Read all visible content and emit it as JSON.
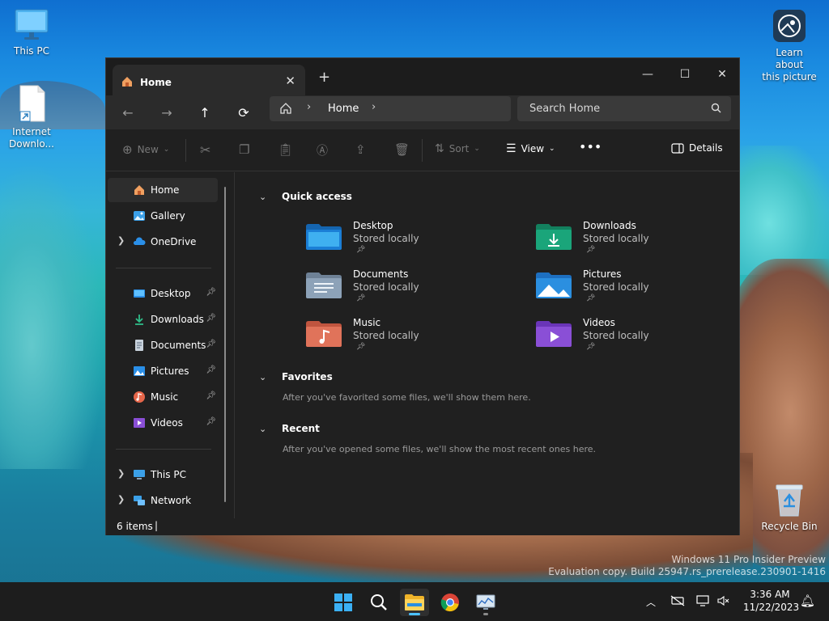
{
  "desktop": {
    "icons": {
      "this_pc": "This PC",
      "internet_download_line1": "Internet",
      "internet_download_line2": "Downlo...",
      "learn_line1": "Learn about",
      "learn_line2": "this picture",
      "recycle_bin": "Recycle Bin"
    },
    "watermark_line1": "Windows 11 Pro Insider Preview",
    "watermark_line2": "Evaluation copy. Build 25947.rs_prerelease.230901-1416"
  },
  "explorer": {
    "tab_title": "Home",
    "address": {
      "current": "Home"
    },
    "search": {
      "placeholder": "Search Home"
    },
    "commands": {
      "new": "New",
      "sort": "Sort",
      "view": "View",
      "details": "Details"
    },
    "sidebar": {
      "top": [
        {
          "label": "Home"
        },
        {
          "label": "Gallery"
        },
        {
          "label": "OneDrive"
        }
      ],
      "pinned": [
        {
          "label": "Desktop"
        },
        {
          "label": "Downloads"
        },
        {
          "label": "Documents"
        },
        {
          "label": "Pictures"
        },
        {
          "label": "Music"
        },
        {
          "label": "Videos"
        }
      ],
      "bottom": [
        {
          "label": "This PC"
        },
        {
          "label": "Network"
        }
      ]
    },
    "sections": {
      "quick_access": "Quick access",
      "favorites": "Favorites",
      "favorites_msg": "After you've favorited some files, we'll show them here.",
      "recent": "Recent",
      "recent_msg": "After you've opened some files, we'll show the most recent ones here."
    },
    "quick_access": [
      {
        "name": "Desktop",
        "sub": "Stored locally",
        "color": "#1b7fd6"
      },
      {
        "name": "Downloads",
        "sub": "Stored locally",
        "color": "#1aa57a"
      },
      {
        "name": "Documents",
        "sub": "Stored locally",
        "color": "#8da2b8"
      },
      {
        "name": "Pictures",
        "sub": "Stored locally",
        "color": "#2b8fe0"
      },
      {
        "name": "Music",
        "sub": "Stored locally",
        "color": "#e0735a"
      },
      {
        "name": "Videos",
        "sub": "Stored locally",
        "color": "#8a4fd6"
      }
    ],
    "status": {
      "items": "6 items"
    }
  },
  "taskbar": {
    "clock_time": "3:36 AM",
    "clock_date": "11/22/2023"
  }
}
